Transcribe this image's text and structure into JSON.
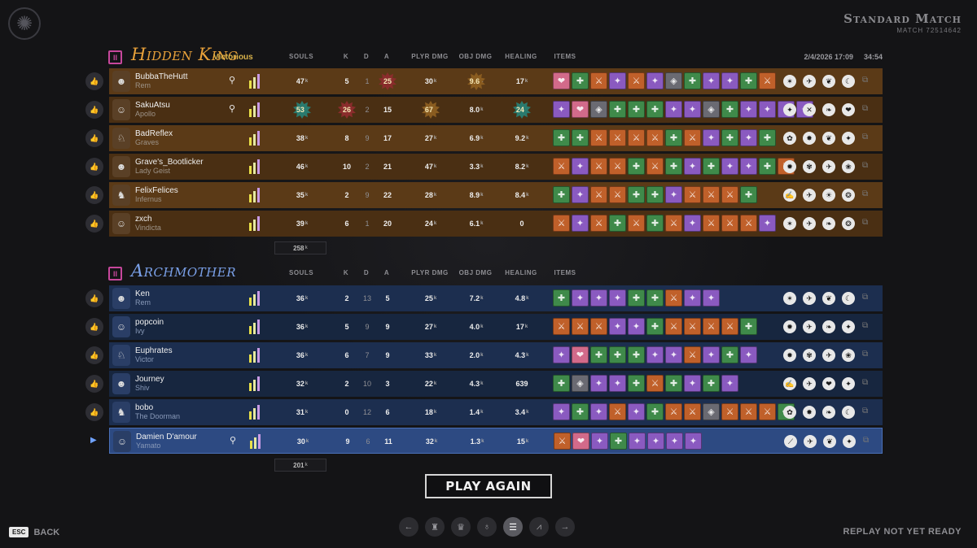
{
  "header": {
    "mode_title": "Standard Match",
    "match_id": "MATCH 72514642",
    "datetime": "2/4/2026 17:09",
    "duration": "34:54"
  },
  "columns": {
    "souls": "SOULS",
    "k": "K",
    "d": "D",
    "a": "A",
    "plyr_dmg": "PLYR DMG",
    "obj_dmg": "OBJ DMG",
    "healing": "HEALING",
    "items": "ITEMS"
  },
  "colors": {
    "amber_row": "#5b3a17",
    "amber_row_alt": "#4a2f13",
    "blue_row": "#1c2e4f",
    "blue_row_alt": "#17263f",
    "accent_gold": "#e8b04a",
    "accent_blue": "#7aa0e8"
  },
  "team1": {
    "icon_label": "II",
    "name": "Hidden King",
    "status": "Victorious",
    "total_souls": "258",
    "players": [
      {
        "name": "BubbaTheHutt",
        "hero": "Rem",
        "souls": "47",
        "k": "5",
        "d": "1",
        "a": "25",
        "plyr_dmg": "30",
        "obj_dmg": "9.6",
        "healing": "17",
        "highlights": [
          "a",
          "obj_dmg"
        ],
        "items": [
          "rose",
          "green",
          "orange",
          "purple",
          "orange",
          "purple",
          "gray",
          "green",
          "purple",
          "purple",
          "green",
          "orange"
        ],
        "abilities": [
          "✶",
          "✈",
          "❦",
          "☾"
        ]
      },
      {
        "name": "SakuAtsu",
        "hero": "Apollo",
        "souls": "53",
        "k": "26",
        "d": "2",
        "a": "15",
        "plyr_dmg": "67",
        "obj_dmg": "8.0",
        "healing": "24",
        "highlights": [
          "souls",
          "k",
          "plyr_dmg",
          "healing"
        ],
        "items": [
          "purple",
          "rose",
          "gray",
          "green",
          "green",
          "green",
          "purple",
          "purple",
          "gray",
          "green",
          "purple",
          "purple",
          "purple",
          "purple"
        ],
        "abilities": [
          "✦",
          "✕",
          "❧",
          "❤"
        ]
      },
      {
        "name": "BadReflex",
        "hero": "Graves",
        "souls": "38",
        "k": "8",
        "d": "9",
        "a": "17",
        "plyr_dmg": "27",
        "obj_dmg": "6.9",
        "healing": "9.2",
        "highlights": [],
        "items": [
          "green",
          "green",
          "orange",
          "orange",
          "orange",
          "orange",
          "green",
          "orange",
          "purple",
          "green",
          "purple",
          "green"
        ],
        "abilities": [
          "✿",
          "✸",
          "❦",
          "✦"
        ]
      },
      {
        "name": "Grave's_Bootlicker",
        "hero": "Lady Geist",
        "souls": "46",
        "k": "10",
        "d": "2",
        "a": "21",
        "plyr_dmg": "47",
        "obj_dmg": "3.3",
        "healing": "8.2",
        "highlights": [],
        "items": [
          "orange",
          "purple",
          "orange",
          "orange",
          "green",
          "orange",
          "green",
          "purple",
          "green",
          "purple",
          "purple",
          "green",
          "orange"
        ],
        "abilities": [
          "✹",
          "✾",
          "✈",
          "❀"
        ]
      },
      {
        "name": "FelixFelices",
        "hero": "Infernus",
        "souls": "35",
        "k": "2",
        "d": "9",
        "a": "22",
        "plyr_dmg": "28",
        "obj_dmg": "8.9",
        "healing": "8.4",
        "highlights": [],
        "items": [
          "green",
          "purple",
          "orange",
          "orange",
          "green",
          "green",
          "purple",
          "orange",
          "orange",
          "orange",
          "green"
        ],
        "abilities": [
          "✍",
          "✈",
          "☀",
          "❂"
        ]
      },
      {
        "name": "zxch",
        "hero": "Vindicta",
        "souls": "39",
        "k": "6",
        "d": "1",
        "a": "20",
        "plyr_dmg": "24",
        "obj_dmg": "6.1",
        "healing": "0",
        "highlights": [],
        "items": [
          "orange",
          "purple",
          "orange",
          "green",
          "orange",
          "green",
          "orange",
          "purple",
          "orange",
          "orange",
          "orange",
          "purple"
        ],
        "abilities": [
          "✶",
          "✈",
          "❧",
          "❂"
        ]
      }
    ]
  },
  "team2": {
    "icon_label": "II",
    "name": "Archmother",
    "total_souls": "201",
    "players": [
      {
        "name": "Ken",
        "hero": "Rem",
        "souls": "36",
        "k": "2",
        "d": "13",
        "a": "5",
        "plyr_dmg": "25",
        "obj_dmg": "7.2",
        "healing": "4.8",
        "items": [
          "green",
          "purple",
          "purple",
          "purple",
          "green",
          "green",
          "orange",
          "purple",
          "purple"
        ],
        "abilities": [
          "✶",
          "✈",
          "❦",
          "☾"
        ],
        "current": false
      },
      {
        "name": "popcoin",
        "hero": "Ivy",
        "souls": "36",
        "k": "5",
        "d": "9",
        "a": "9",
        "plyr_dmg": "27",
        "obj_dmg": "4.0",
        "healing": "17",
        "items": [
          "orange",
          "orange",
          "orange",
          "purple",
          "purple",
          "green",
          "orange",
          "orange",
          "orange",
          "orange",
          "green"
        ],
        "abilities": [
          "✹",
          "✈",
          "❧",
          "✦"
        ],
        "current": false
      },
      {
        "name": "Euphrates",
        "hero": "Victor",
        "souls": "36",
        "k": "6",
        "d": "7",
        "a": "9",
        "plyr_dmg": "33",
        "obj_dmg": "2.0",
        "healing": "4.3",
        "items": [
          "purple",
          "rose",
          "green",
          "green",
          "green",
          "purple",
          "purple",
          "orange",
          "purple",
          "green",
          "purple"
        ],
        "abilities": [
          "✸",
          "✾",
          "✈",
          "❀"
        ],
        "current": false
      },
      {
        "name": "Journey",
        "hero": "Shiv",
        "souls": "32",
        "k": "2",
        "d": "10",
        "a": "3",
        "plyr_dmg": "22",
        "obj_dmg": "4.3",
        "healing": "639",
        "items": [
          "green",
          "gray",
          "purple",
          "purple",
          "green",
          "orange",
          "green",
          "purple",
          "green",
          "purple"
        ],
        "abilities": [
          "✍",
          "✈",
          "❤",
          "✦"
        ],
        "current": false
      },
      {
        "name": "bobo",
        "hero": "The Doorman",
        "souls": "31",
        "k": "0",
        "d": "12",
        "a": "6",
        "plyr_dmg": "18",
        "obj_dmg": "1.4",
        "healing": "3.4",
        "items": [
          "purple",
          "green",
          "purple",
          "orange",
          "purple",
          "green",
          "orange",
          "orange",
          "gray",
          "orange",
          "orange",
          "orange",
          "green"
        ],
        "abilities": [
          "✿",
          "✸",
          "❧",
          "☾"
        ],
        "current": false
      },
      {
        "name": "Damien D'amour",
        "hero": "Yamato",
        "souls": "30",
        "k": "9",
        "d": "6",
        "a": "11",
        "plyr_dmg": "32",
        "obj_dmg": "1.3",
        "healing": "15",
        "items": [
          "orange",
          "rose",
          "purple",
          "green",
          "purple",
          "purple",
          "purple",
          "purple"
        ],
        "abilities": [
          "⟋",
          "✈",
          "❦",
          "✦"
        ],
        "current": true
      }
    ]
  },
  "footer": {
    "play_again": "PLAY AGAIN",
    "esc_key": "ESC",
    "back_label": "BACK",
    "replay_status": "REPLAY NOT YET READY"
  },
  "nav": [
    {
      "icon": "arrow-left-icon",
      "glyph": "←"
    },
    {
      "icon": "trophy-icon",
      "glyph": "♜"
    },
    {
      "icon": "crown-icon",
      "glyph": "♛"
    },
    {
      "icon": "lantern-icon",
      "glyph": "♁"
    },
    {
      "icon": "list-icon",
      "glyph": "☰",
      "active": true
    },
    {
      "icon": "graph-icon",
      "glyph": "⩘"
    },
    {
      "icon": "arrow-right-icon",
      "glyph": "→"
    }
  ]
}
